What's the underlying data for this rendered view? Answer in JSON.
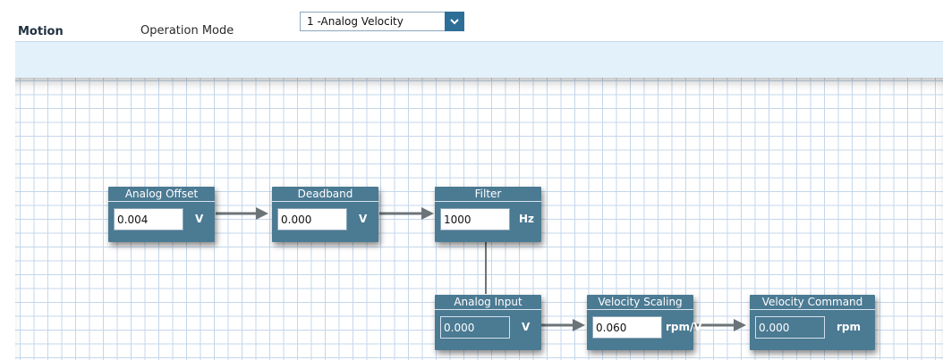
{
  "header": {
    "section_label": "Motion",
    "operation_mode_label": "Operation Mode",
    "operation_mode_value": "1 -Analog Velocity"
  },
  "blocks": {
    "analog_offset": {
      "title": "Analog Offset",
      "value": "0.004",
      "unit": "V"
    },
    "deadband": {
      "title": "Deadband",
      "value": "0.000",
      "unit": "V"
    },
    "filter": {
      "title": "Filter",
      "value": "1000",
      "unit": "Hz"
    },
    "analog_input": {
      "title": "Analog Input",
      "value": "0.000",
      "unit": "V"
    },
    "velocity_scaling": {
      "title": "Velocity Scaling",
      "value": "0.060",
      "unit": "rpm/V"
    },
    "velocity_command": {
      "title": "Velocity Command",
      "value": "0.000",
      "unit": "rpm"
    }
  },
  "colors": {
    "block_fill": "#4b7a93",
    "grid_line": "#c4d7eb",
    "dropdown_button": "#2e6f98",
    "tab_band": "#e3f1fb"
  },
  "icons": {
    "dropdown": "chevron-down-icon",
    "connector": "arrow-right-icon"
  }
}
